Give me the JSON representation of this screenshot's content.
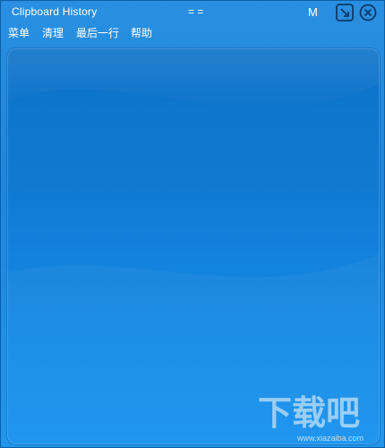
{
  "window": {
    "title": "Clipboard History",
    "title_mark": "= =",
    "mode_button_label": "M"
  },
  "toolbar": {
    "resize_icon": "resize-icon",
    "close_icon": "close-icon"
  },
  "menu": {
    "items": [
      {
        "label": "菜单"
      },
      {
        "label": "清理"
      },
      {
        "label": "最后一行"
      },
      {
        "label": "帮助"
      }
    ]
  },
  "watermark": {
    "logo_text": "下载吧",
    "site_text": "www.xiazaiba.com"
  },
  "colors": {
    "window_bg": "#1e86dc",
    "panel_bg": "#107ad3",
    "text": "#ffffff"
  }
}
